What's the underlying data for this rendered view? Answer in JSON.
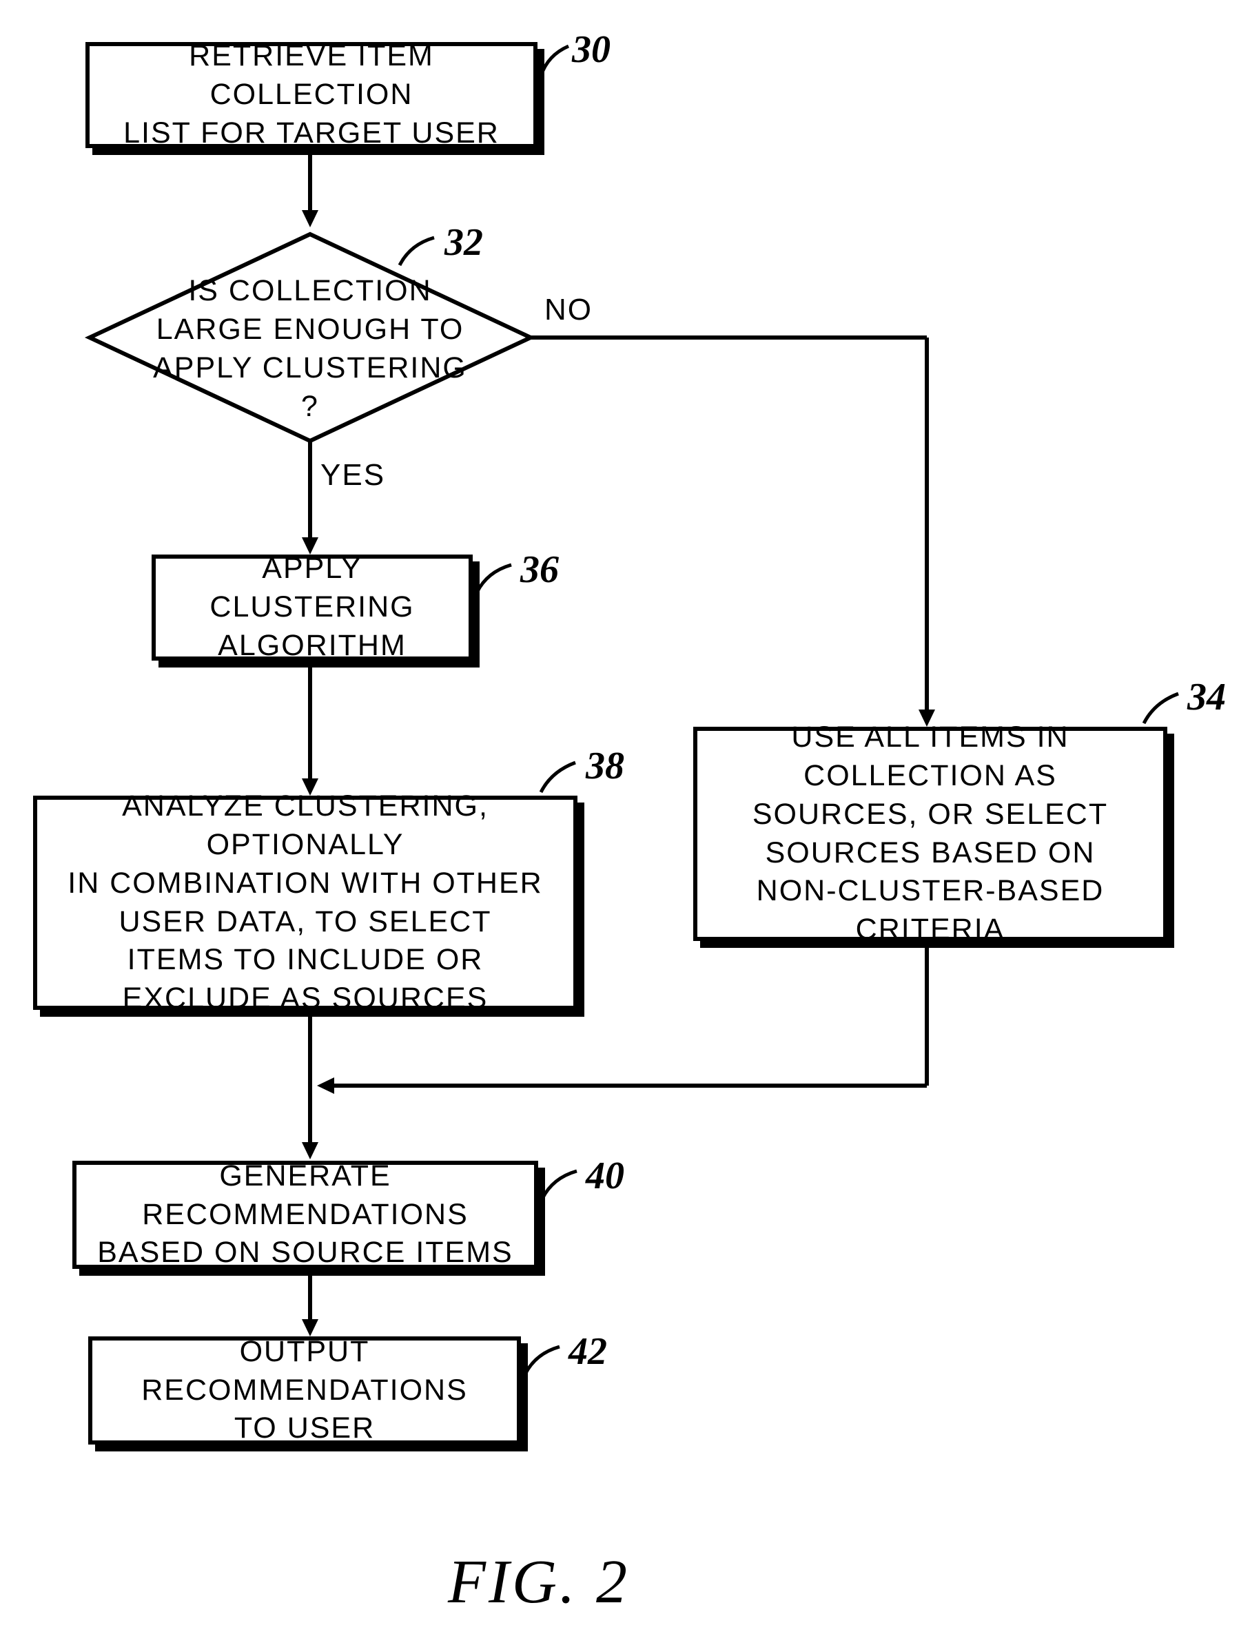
{
  "boxes": {
    "box30": "RETRIEVE ITEM COLLECTION\nLIST FOR TARGET USER",
    "box32": "IS COLLECTION\nLARGE ENOUGH TO\nAPPLY CLUSTERING\n?",
    "box36": "APPLY CLUSTERING\nALGORITHM",
    "box38": "ANALYZE CLUSTERING, OPTIONALLY\nIN COMBINATION WITH OTHER\nUSER DATA, TO SELECT\nITEMS TO INCLUDE OR\nEXCLUDE AS SOURCES",
    "box34": "USE ALL ITEMS IN\nCOLLECTION AS\nSOURCES, OR SELECT\nSOURCES BASED ON\nNON-CLUSTER-BASED CRITERIA",
    "box40": "GENERATE RECOMMENDATIONS\nBASED ON SOURCE ITEMS",
    "box42": "OUTPUT RECOMMENDATIONS\nTO USER"
  },
  "labels": {
    "l30": "30",
    "l32": "32",
    "l36": "36",
    "l38": "38",
    "l34": "34",
    "l40": "40",
    "l42": "42"
  },
  "edges": {
    "yes": "YES",
    "no": "NO"
  },
  "figure": "FIG.  2",
  "chart_data": {
    "type": "flowchart",
    "nodes": [
      {
        "id": 30,
        "type": "process",
        "text": "RETRIEVE ITEM COLLECTION LIST FOR TARGET USER"
      },
      {
        "id": 32,
        "type": "decision",
        "text": "IS COLLECTION LARGE ENOUGH TO APPLY CLUSTERING ?"
      },
      {
        "id": 36,
        "type": "process",
        "text": "APPLY CLUSTERING ALGORITHM"
      },
      {
        "id": 38,
        "type": "process",
        "text": "ANALYZE CLUSTERING, OPTIONALLY IN COMBINATION WITH OTHER USER DATA, TO SELECT ITEMS TO INCLUDE OR EXCLUDE AS SOURCES"
      },
      {
        "id": 34,
        "type": "process",
        "text": "USE ALL ITEMS IN COLLECTION AS SOURCES, OR SELECT SOURCES BASED ON NON-CLUSTER-BASED CRITERIA"
      },
      {
        "id": 40,
        "type": "process",
        "text": "GENERATE RECOMMENDATIONS BASED ON SOURCE ITEMS"
      },
      {
        "id": 42,
        "type": "process",
        "text": "OUTPUT RECOMMENDATIONS TO USER"
      }
    ],
    "edges": [
      {
        "from": 30,
        "to": 32
      },
      {
        "from": 32,
        "to": 36,
        "label": "YES"
      },
      {
        "from": 32,
        "to": 34,
        "label": "NO"
      },
      {
        "from": 36,
        "to": 38
      },
      {
        "from": 38,
        "to": 40
      },
      {
        "from": 34,
        "to": 40
      },
      {
        "from": 40,
        "to": 42
      }
    ]
  }
}
